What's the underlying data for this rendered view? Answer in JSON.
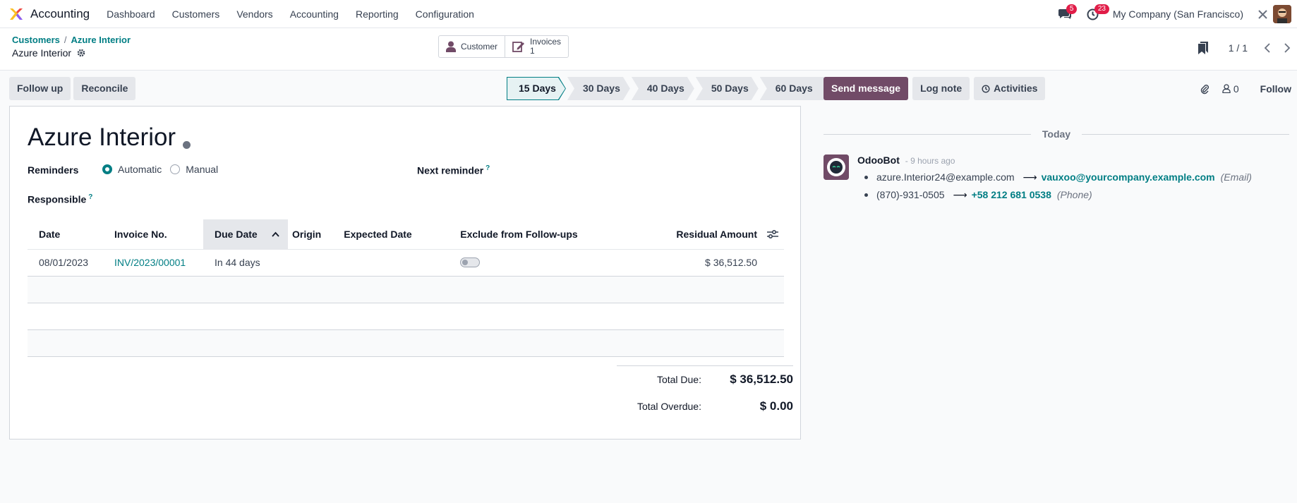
{
  "nav": {
    "app_name": "Accounting",
    "menu": [
      "Dashboard",
      "Customers",
      "Vendors",
      "Accounting",
      "Reporting",
      "Configuration"
    ],
    "messages_count": "5",
    "activities_count": "23",
    "company": "My Company (San Francisco)"
  },
  "breadcrumb": {
    "parent": "Customers",
    "current": "Azure Interior"
  },
  "record": {
    "title": "Azure Interior"
  },
  "smart_buttons": {
    "customer": "Customer",
    "invoices_label": "Invoices",
    "invoices_count": "1"
  },
  "pager": {
    "text": "1 / 1"
  },
  "actions": {
    "follow_up": "Follow up",
    "reconcile": "Reconcile"
  },
  "stages": [
    "15 Days",
    "30 Days",
    "40 Days",
    "50 Days",
    "60 Days"
  ],
  "active_stage": "15 Days",
  "form": {
    "partner_name": "Azure Interior",
    "reminders_label": "Reminders",
    "reminder_automatic": "Automatic",
    "reminder_manual": "Manual",
    "next_reminder_label": "Next reminder",
    "responsible_label": "Responsible",
    "help_mark": "?"
  },
  "table": {
    "columns": [
      "Date",
      "Invoice No.",
      "Due Date",
      "Origin",
      "Expected Date",
      "Exclude from Follow-ups",
      "Residual Amount"
    ],
    "rows": [
      {
        "date": "08/01/2023",
        "invoice": "INV/2023/00001",
        "due": "In 44 days",
        "origin": "",
        "expected": "",
        "residual": "$ 36,512.50"
      }
    ]
  },
  "totals": {
    "due_label": "Total Due:",
    "due_value": "$ 36,512.50",
    "overdue_label": "Total Overdue:",
    "overdue_value": "$ 0.00"
  },
  "chatter": {
    "send_message": "Send message",
    "log_note": "Log note",
    "activities": "Activities",
    "followers_count": "0",
    "follow": "Follow",
    "today": "Today",
    "message": {
      "author": "OdooBot",
      "time": "- 9 hours ago",
      "changes": [
        {
          "old": "azure.Interior24@example.com",
          "new": "vauxoo@yourcompany.example.com",
          "field": "(Email)"
        },
        {
          "old": "(870)-931-0505",
          "new": "+58 212 681 0538",
          "field": "(Phone)"
        }
      ]
    }
  },
  "colors": {
    "brand": "#714b67",
    "accent": "#017e84",
    "badge": "#e11d48"
  }
}
